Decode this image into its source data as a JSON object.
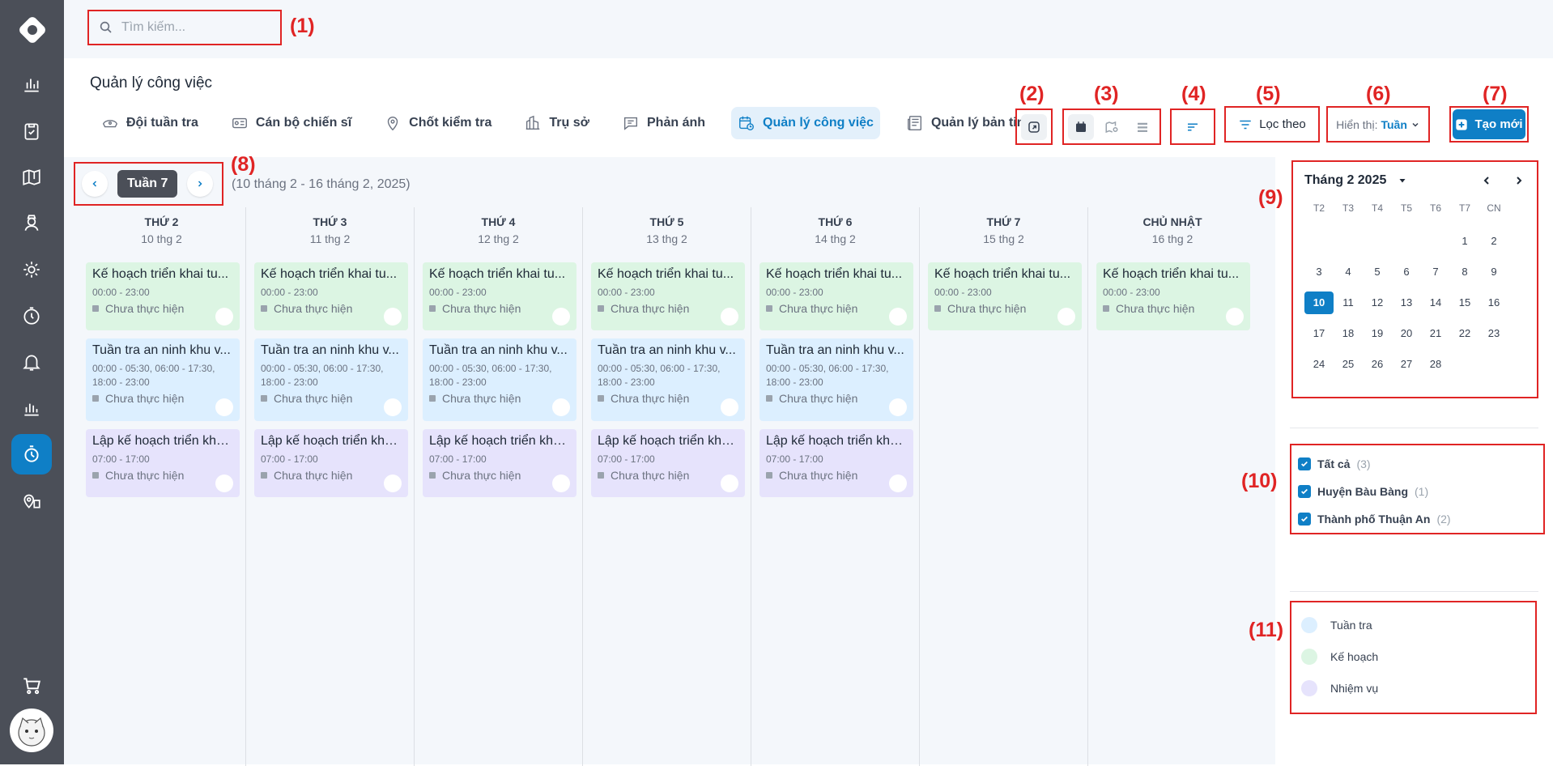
{
  "search": {
    "placeholder": "Tìm kiếm..."
  },
  "markers": [
    "(1)",
    "(2)",
    "(3)",
    "(4)",
    "(5)",
    "(6)",
    "(7)",
    "(8)",
    "(9)",
    "(10)",
    "(11)"
  ],
  "page": {
    "title": "Quản lý công việc"
  },
  "tabs": [
    {
      "label": "Đội tuần tra",
      "icon": "police-hat-icon"
    },
    {
      "label": "Cán bộ chiến sĩ",
      "icon": "id-card-icon"
    },
    {
      "label": "Chốt kiểm tra",
      "icon": "location-pin-icon"
    },
    {
      "label": "Trụ sở",
      "icon": "building-icon"
    },
    {
      "label": "Phản ánh",
      "icon": "message-icon"
    },
    {
      "label": "Quản lý công việc",
      "icon": "calendar-clock-icon"
    },
    {
      "label": "Quản lý bản tin",
      "icon": "newspaper-icon"
    }
  ],
  "toolbar": {
    "filter_label": "Lọc theo",
    "display_label": "Hiển thị:",
    "display_value": "Tuần",
    "create_label": "Tạo mới"
  },
  "week": {
    "label": "Tuần 7",
    "range": "(10 tháng 2 - 16 tháng 2, 2025)"
  },
  "days": [
    {
      "name": "THỨ 2",
      "date": "10 thg 2"
    },
    {
      "name": "THỨ 3",
      "date": "11 thg 2"
    },
    {
      "name": "THỨ 4",
      "date": "12 thg 2"
    },
    {
      "name": "THỨ 5",
      "date": "13 thg 2"
    },
    {
      "name": "THỨ 6",
      "date": "14 thg 2"
    },
    {
      "name": "THỨ 7",
      "date": "15 thg 2"
    },
    {
      "name": "CHỦ NHẬT",
      "date": "16 thg 2"
    }
  ],
  "events": {
    "plan": {
      "title": "Kế hoạch triển khai tu...",
      "time": "00:00 - 23:00",
      "status": "Chưa thực hiện"
    },
    "patrol": {
      "title": "Tuần tra an ninh khu v...",
      "time": "00:00 - 05:30, 06:00 - 17:30, 18:00 - 23:00",
      "status": "Chưa thực hiện"
    },
    "task": {
      "title": "Lập kế hoạch triển kha...",
      "time": "07:00 - 17:00",
      "status": "Chưa thực hiện"
    }
  },
  "calendar": {
    "month_label": "Tháng 2 2025",
    "weekdays": [
      "T2",
      "T3",
      "T4",
      "T5",
      "T6",
      "T7",
      "CN"
    ],
    "days": [
      "",
      "",
      "",
      "",
      "",
      "1",
      "2",
      "3",
      "4",
      "5",
      "6",
      "7",
      "8",
      "9",
      "10",
      "11",
      "12",
      "13",
      "14",
      "15",
      "16",
      "17",
      "18",
      "19",
      "20",
      "21",
      "22",
      "23",
      "24",
      "25",
      "26",
      "27",
      "28"
    ],
    "selected": "10"
  },
  "areas": [
    {
      "label": "Tất cả",
      "count": "(3)"
    },
    {
      "label": "Huyện Bàu Bàng",
      "count": "(1)"
    },
    {
      "label": "Thành phố Thuận An",
      "count": "(2)"
    }
  ],
  "legend": [
    {
      "label": "Tuần tra",
      "color": "#dcefff"
    },
    {
      "label": "Kế hoạch",
      "color": "#dcf5e3"
    },
    {
      "label": "Nhiệm vụ",
      "color": "#e6e3fc"
    }
  ],
  "colors": {
    "accent": "#0f7fc6",
    "sidebar": "#4b4f58",
    "marker": "#e02424"
  }
}
